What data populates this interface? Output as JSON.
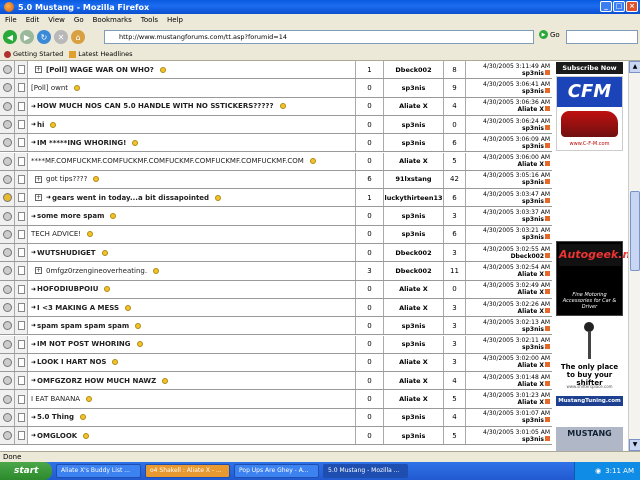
{
  "window": {
    "title": "5.0 Mustang - Mozilla Firefox"
  },
  "menu": [
    "File",
    "Edit",
    "View",
    "Go",
    "Bookmarks",
    "Tools",
    "Help"
  ],
  "address": {
    "url": "http://www.mustangforums.com/tt.asp?forumid=14",
    "go_label": "Go"
  },
  "bookmarks": [
    "Getting Started",
    "Latest Headlines"
  ],
  "threads": [
    {
      "title": "[Poll] WAGE WAR ON WHO?",
      "expand": true,
      "bold": true,
      "arrow": false,
      "replies": "1",
      "author": "Dbeck002",
      "views": "8",
      "date": "4/30/2005 3:11:49 AM",
      "by": "sp3nis",
      "hot": false
    },
    {
      "title": "[Poll] ownt",
      "expand": false,
      "bold": false,
      "arrow": false,
      "replies": "0",
      "author": "sp3nis",
      "views": "9",
      "date": "4/30/2005 3:06:41 AM",
      "by": "sp3nis",
      "hot": false
    },
    {
      "title": "HOW MUCH NOS CAN 5.0 HANDLE WITH NO SSTICKERS?????",
      "expand": false,
      "bold": true,
      "arrow": true,
      "replies": "0",
      "author": "Aliate X",
      "views": "4",
      "date": "4/30/2005 3:06:36 AM",
      "by": "Aliate X",
      "hot": false
    },
    {
      "title": "hi",
      "expand": false,
      "bold": true,
      "arrow": true,
      "replies": "0",
      "author": "sp3nis",
      "views": "0",
      "date": "4/30/2005 3:06:24 AM",
      "by": "sp3nis",
      "hot": false
    },
    {
      "title": "IM *****ING WHORING!",
      "expand": false,
      "bold": true,
      "arrow": true,
      "replies": "0",
      "author": "sp3nis",
      "views": "6",
      "date": "4/30/2005 3:06:09 AM",
      "by": "sp3nis",
      "hot": false
    },
    {
      "title": "****MF.COMFUCKMF.COMFUCKMF.COMFUCKMF.COMFUCKMF.COMFUCKMF.COM",
      "expand": false,
      "bold": false,
      "arrow": false,
      "replies": "0",
      "author": "Aliate X",
      "views": "5",
      "date": "4/30/2005 3:06:00 AM",
      "by": "Aliate X",
      "hot": false
    },
    {
      "title": "got tips????",
      "expand": true,
      "bold": false,
      "arrow": false,
      "replies": "6",
      "author": "91lxstang",
      "views": "42",
      "date": "4/30/2005 3:05:16 AM",
      "by": "sp3nis",
      "hot": false
    },
    {
      "title": "gears went in today...a bit dissapointed",
      "expand": true,
      "bold": true,
      "arrow": true,
      "replies": "1",
      "author": "luckythirteen13",
      "views": "6",
      "date": "4/30/2005 3:03:47 AM",
      "by": "sp3nis",
      "hot": true
    },
    {
      "title": "some more spam",
      "expand": false,
      "bold": true,
      "arrow": true,
      "replies": "0",
      "author": "sp3nis",
      "views": "3",
      "date": "4/30/2005 3:03:37 AM",
      "by": "sp3nis",
      "hot": false
    },
    {
      "title": "TECH ADVICE!",
      "expand": false,
      "bold": false,
      "arrow": false,
      "replies": "0",
      "author": "sp3nis",
      "views": "6",
      "date": "4/30/2005 3:03:21 AM",
      "by": "sp3nis",
      "hot": false
    },
    {
      "title": "WUTSHUDIGET",
      "expand": false,
      "bold": true,
      "arrow": true,
      "replies": "0",
      "author": "Dbeck002",
      "views": "3",
      "date": "4/30/2005 3:02:55 AM",
      "by": "Dbeck002",
      "hot": false
    },
    {
      "title": "0mfgz0rzengineoverheating.",
      "expand": true,
      "bold": false,
      "arrow": false,
      "replies": "3",
      "author": "Dbeck002",
      "views": "11",
      "date": "4/30/2005 3:02:54 AM",
      "by": "Aliate X",
      "hot": false
    },
    {
      "title": "HOFODIUBPOIU",
      "expand": false,
      "bold": true,
      "arrow": true,
      "replies": "0",
      "author": "Aliate X",
      "views": "0",
      "date": "4/30/2005 3:02:49 AM",
      "by": "Aliate X",
      "hot": false
    },
    {
      "title": "I <3 MAKING A MESS",
      "expand": false,
      "bold": true,
      "arrow": true,
      "replies": "0",
      "author": "Aliate X",
      "views": "3",
      "date": "4/30/2005 3:02:26 AM",
      "by": "Aliate X",
      "hot": false
    },
    {
      "title": "spam spam spam spam",
      "expand": false,
      "bold": true,
      "arrow": true,
      "replies": "0",
      "author": "sp3nis",
      "views": "3",
      "date": "4/30/2005 3:02:13 AM",
      "by": "sp3nis",
      "hot": false
    },
    {
      "title": "IM NOT POST WHORING",
      "expand": false,
      "bold": true,
      "arrow": true,
      "replies": "0",
      "author": "sp3nis",
      "views": "3",
      "date": "4/30/2005 3:02:11 AM",
      "by": "sp3nis",
      "hot": false
    },
    {
      "title": "LOOK I HART NOS",
      "expand": false,
      "bold": true,
      "arrow": true,
      "replies": "0",
      "author": "Aliate X",
      "views": "3",
      "date": "4/30/2005 3:02:00 AM",
      "by": "Aliate X",
      "hot": false
    },
    {
      "title": "OMFGZORZ HOW MUCH NAWZ",
      "expand": false,
      "bold": true,
      "arrow": true,
      "replies": "0",
      "author": "Aliate X",
      "views": "4",
      "date": "4/30/2005 3:01:48 AM",
      "by": "Aliate X",
      "hot": false
    },
    {
      "title": "I EAT BANANA",
      "expand": false,
      "bold": false,
      "arrow": false,
      "replies": "0",
      "author": "Aliate X",
      "views": "5",
      "date": "4/30/2005 3:01:23 AM",
      "by": "Aliate X",
      "hot": false
    },
    {
      "title": "5.0 Thing",
      "expand": false,
      "bold": true,
      "arrow": true,
      "replies": "0",
      "author": "sp3nis",
      "views": "4",
      "date": "4/30/2005 3:01:07 AM",
      "by": "sp3nis",
      "hot": false
    },
    {
      "title": "OMGLOOK",
      "expand": false,
      "bold": true,
      "arrow": true,
      "replies": "0",
      "author": "sp3nis",
      "views": "5",
      "date": "4/30/2005 3:01:05 AM",
      "by": "sp3nis",
      "hot": false
    }
  ],
  "sidebar": {
    "subscribe": "Subscribe Now",
    "cfm_logo": "CFM",
    "cfm_url": "www.C-F-M.com",
    "auto_logo": "Autogeek.net",
    "auto_tag": "Fine Motoring Accessories for Car & Driver",
    "only_place": "The only place to buy your shifter",
    "shifter_url": "www.shiftersplace.com",
    "mustangtuning": "MustangTuning.com",
    "mustang": "MUSTANG"
  },
  "status": "Done",
  "taskbar": {
    "start": "start",
    "tasks": [
      "Aliate X's Buddy List ...",
      "o4 Shakell : Aliate X - ...",
      "Pop Ups Are Ghey - A...",
      "5.0 Mustang - Mozilla ..."
    ],
    "clock": "3:11 AM"
  },
  "colors": {
    "titlebar": "#0a5ae0",
    "taskbar": "#225ad0",
    "start": "#2c8a2c",
    "chrome": "#ece9d8"
  }
}
